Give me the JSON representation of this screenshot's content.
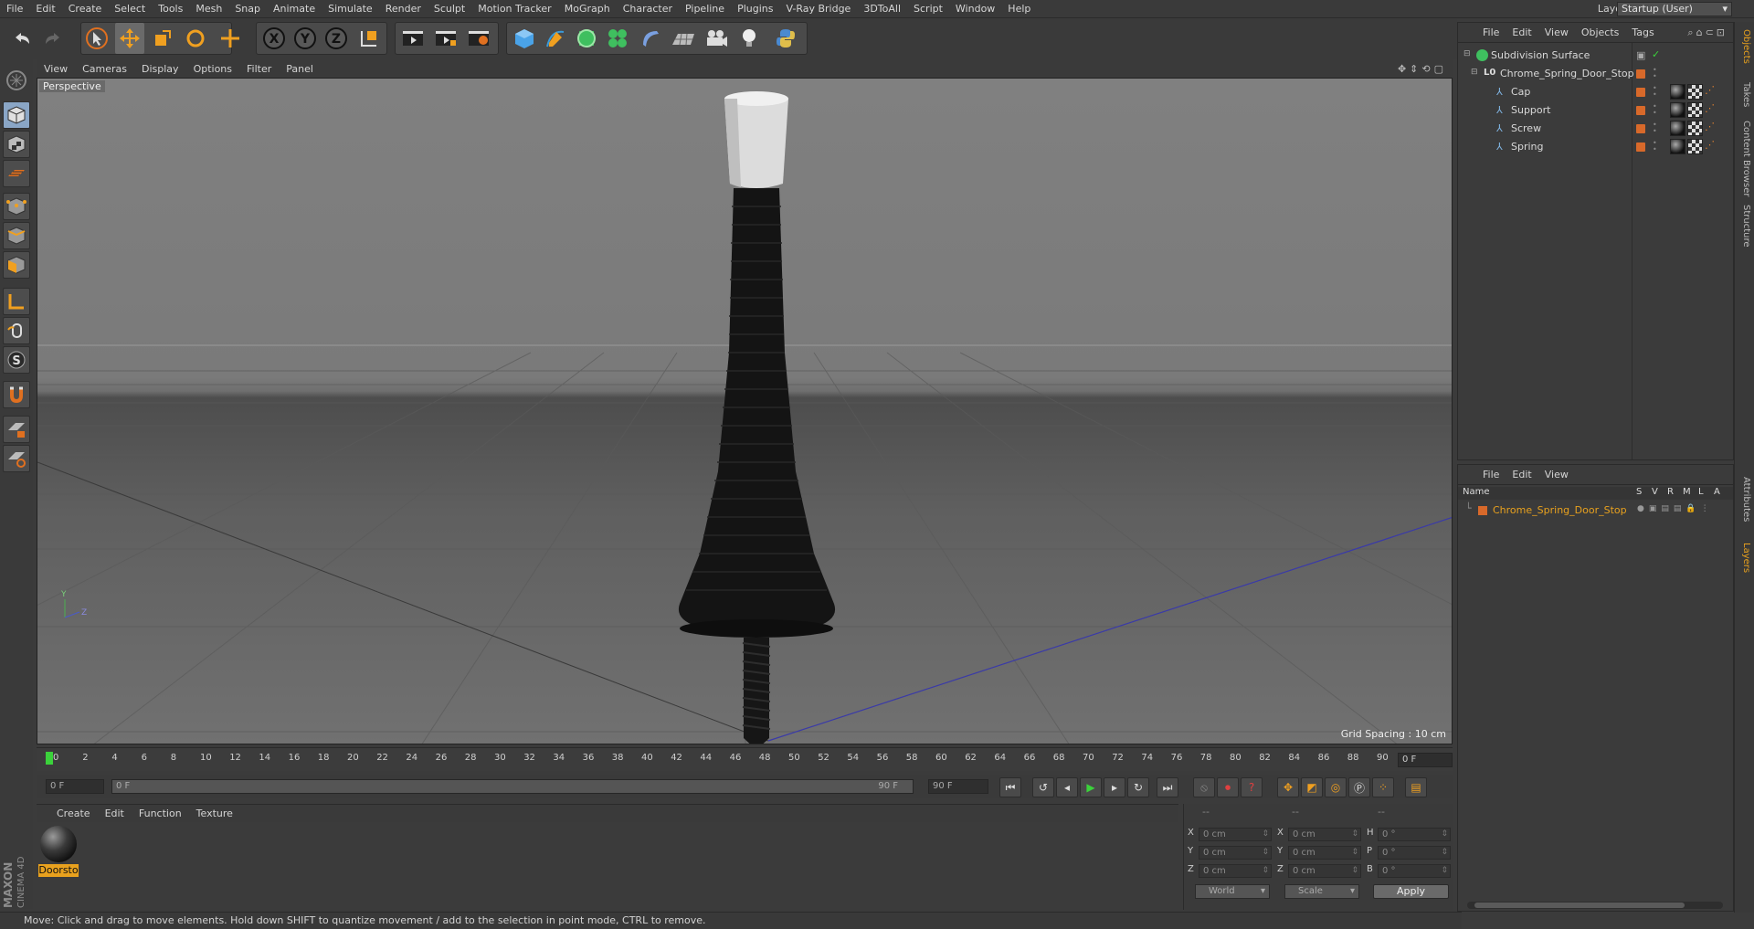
{
  "menubar": {
    "items": [
      "File",
      "Edit",
      "Create",
      "Select",
      "Tools",
      "Mesh",
      "Snap",
      "Animate",
      "Simulate",
      "Render",
      "Sculpt",
      "Motion Tracker",
      "MoGraph",
      "Character",
      "Pipeline",
      "Plugins",
      "V-Ray Bridge",
      "3DToAll",
      "Script",
      "Window",
      "Help"
    ],
    "layout_label": "Layout:",
    "layout_value": "Startup (User)"
  },
  "viewport": {
    "menu": [
      "View",
      "Cameras",
      "Display",
      "Options",
      "Filter",
      "Panel"
    ],
    "label": "Perspective",
    "grid_spacing": "Grid Spacing : 10 cm",
    "axis_y": "Y",
    "axis_z": "Z"
  },
  "timeline": {
    "ticks": [
      "0",
      "2",
      "4",
      "6",
      "8",
      "10",
      "12",
      "14",
      "16",
      "18",
      "20",
      "22",
      "24",
      "26",
      "28",
      "30",
      "32",
      "34",
      "36",
      "38",
      "40",
      "42",
      "44",
      "46",
      "48",
      "50",
      "52",
      "54",
      "56",
      "58",
      "60",
      "62",
      "64",
      "66",
      "68",
      "70",
      "72",
      "74",
      "76",
      "78",
      "80",
      "82",
      "84",
      "86",
      "88",
      "90"
    ],
    "current_frame": "0 F"
  },
  "transport": {
    "start_field": "0 F",
    "range_start": "0 F",
    "range_end": "90 F",
    "end_field": "90 F"
  },
  "material_manager": {
    "menu": [
      "Create",
      "Edit",
      "Function",
      "Texture"
    ],
    "material_name": "Doorsto"
  },
  "coordinates": {
    "header": [
      "--",
      "--",
      "--"
    ],
    "rows": [
      {
        "l1": "X",
        "v1": "0 cm",
        "l2": "X",
        "v2": "0 cm",
        "l3": "H",
        "v3": "0 °"
      },
      {
        "l1": "Y",
        "v1": "0 cm",
        "l2": "Y",
        "v2": "0 cm",
        "l3": "P",
        "v3": "0 °"
      },
      {
        "l1": "Z",
        "v1": "0 cm",
        "l2": "Z",
        "v2": "0 cm",
        "l3": "B",
        "v3": "0 °"
      }
    ],
    "space": "World",
    "mode": "Scale",
    "apply": "Apply"
  },
  "object_manager": {
    "menu": [
      "File",
      "Edit",
      "View",
      "Objects",
      "Tags"
    ],
    "objects": [
      {
        "name": "Subdivision Surface"
      },
      {
        "name": "Chrome_Spring_Door_Stop"
      },
      {
        "name": "Cap"
      },
      {
        "name": "Support"
      },
      {
        "name": "Screw"
      },
      {
        "name": "Spring"
      }
    ]
  },
  "side_tabs": [
    "Objects",
    "Takes",
    "Content Browser",
    "Structure",
    "Attributes",
    "Layers"
  ],
  "layer_manager": {
    "menu": [
      "File",
      "Edit",
      "View"
    ],
    "columns": [
      "Name",
      "S",
      "V",
      "R",
      "M",
      "L",
      "A"
    ],
    "layer_name": "Chrome_Spring_Door_Stop"
  },
  "logo": {
    "line1": "MAXON",
    "line2": "CINEMA 4D"
  },
  "status": "Move: Click and drag to move elements. Hold down SHIFT to quantize movement / add to the selection in point mode, CTRL to remove.",
  "colors": {
    "accent": "#e8a11e",
    "object_orange": "#d8692a",
    "selected_blue": "#8fb6d9"
  }
}
